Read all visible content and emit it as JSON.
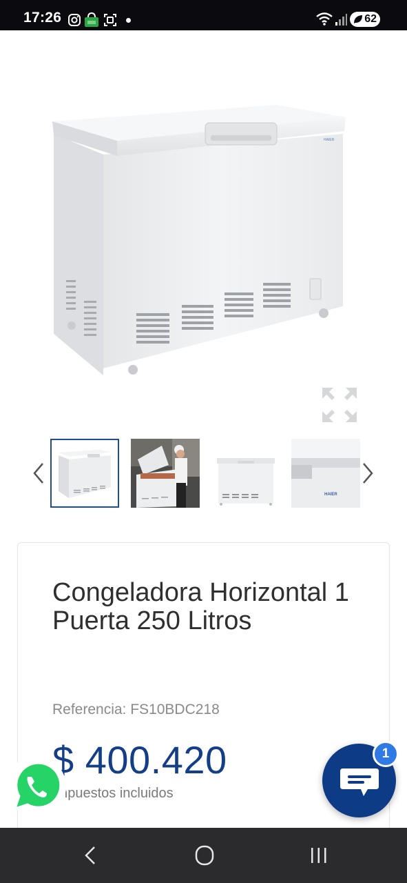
{
  "status_bar": {
    "time": "17:26",
    "battery": "62",
    "icons": [
      "instagram-icon",
      "cart-notification-icon",
      "screenshot-icon",
      "wifi-icon",
      "signal-icon"
    ]
  },
  "product": {
    "image_alt": "Congeladora horizontal blanca",
    "thumbnails": [
      "freezer-front-thumb",
      "freezer-in-kitchen-thumb",
      "freezer-front-small-thumb",
      "freezer-detail-logo-thumb"
    ],
    "title": "Congeladora Horizontal 1 Puerta 250 Litros",
    "reference": "Referencia: FS10BDC218",
    "price": "$ 400.420",
    "tax_note": "Impuestos incluidos"
  },
  "chat": {
    "badge_count": "1"
  },
  "colors": {
    "price_blue": "#143e86",
    "chat_blue": "#0d3b86",
    "badge_blue": "#2f7ae5",
    "whatsapp_green": "#25d366"
  }
}
